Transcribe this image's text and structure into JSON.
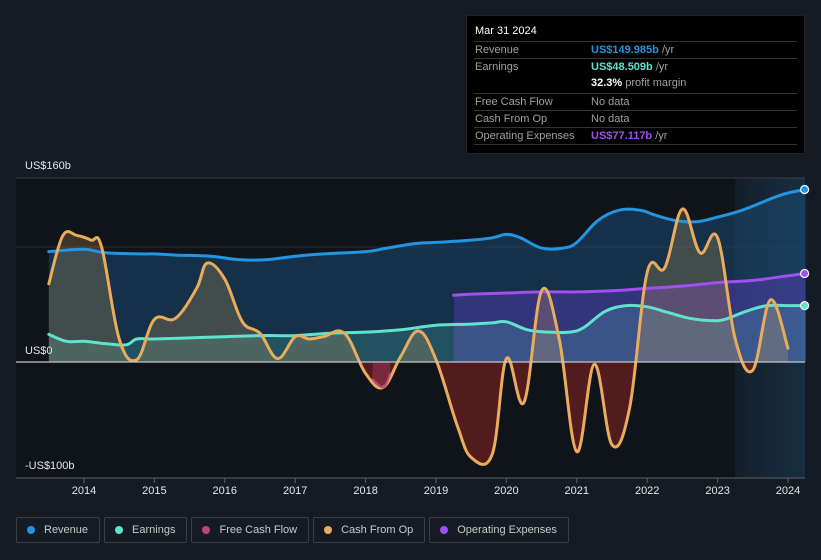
{
  "tooltip": {
    "date": "Mar 31 2024",
    "rows": [
      {
        "label": "Revenue",
        "value": "US$149.985b",
        "suffix": " /yr",
        "color": "#2394df"
      },
      {
        "label": "Earnings",
        "value": "US$48.509b",
        "suffix": " /yr",
        "color": "#5fe3cc"
      },
      {
        "label": "",
        "value": "32.3%",
        "suffix": " profit margin",
        "color": "#ffffff"
      },
      {
        "label": "Free Cash Flow",
        "value": "",
        "suffix": "No data",
        "color": "#6f6f6f"
      },
      {
        "label": "Cash From Op",
        "value": "",
        "suffix": "No data",
        "color": "#6f6f6f"
      },
      {
        "label": "Operating Expenses",
        "value": "US$77.117b",
        "suffix": " /yr",
        "color": "#a14ff0"
      }
    ]
  },
  "legend": [
    {
      "label": "Revenue",
      "color": "#2394df"
    },
    {
      "label": "Earnings",
      "color": "#5fe3cc"
    },
    {
      "label": "Free Cash Flow",
      "color": "#c0447a"
    },
    {
      "label": "Cash From Op",
      "color": "#e9ac5c"
    },
    {
      "label": "Operating Expenses",
      "color": "#a14ff0"
    }
  ],
  "chart_data": {
    "type": "area",
    "title": "",
    "xlabel": "",
    "ylabel": "",
    "ylim": [
      -100,
      160
    ],
    "y_tick_labels": [
      "US$160b",
      "US$0",
      "-US$100b"
    ],
    "x_tick_labels": [
      "2014",
      "2015",
      "2016",
      "2017",
      "2018",
      "2019",
      "2020",
      "2021",
      "2022",
      "2023",
      "2024"
    ],
    "x_ticks": [
      2014,
      2015,
      2016,
      2017,
      2018,
      2019,
      2020,
      2021,
      2022,
      2023,
      2024
    ],
    "xlim": [
      2013.2,
      2024.25
    ],
    "forecast_start": 2023.25,
    "grid": true,
    "legend_position": "bottom",
    "series": [
      {
        "name": "Revenue",
        "color": "#2394df",
        "x": [
          2013.5,
          2014.0,
          2014.3,
          2014.8,
          2015.0,
          2015.3,
          2015.8,
          2016.2,
          2016.6,
          2017.0,
          2017.4,
          2018.0,
          2018.3,
          2018.7,
          2019.0,
          2019.5,
          2019.8,
          2020.0,
          2020.2,
          2020.5,
          2020.8,
          2021.0,
          2021.3,
          2021.6,
          2021.9,
          2022.1,
          2022.4,
          2022.7,
          2023.0,
          2023.3,
          2023.6,
          2023.8,
          2024.0,
          2024.25
        ],
        "values": [
          96,
          98,
          95,
          94,
          94,
          93,
          92,
          89,
          89,
          92,
          94,
          96,
          99,
          103,
          104,
          106,
          108,
          111,
          108,
          99,
          99,
          104,
          123,
          132,
          132,
          128,
          123,
          122,
          126,
          131,
          138,
          143,
          147,
          150
        ]
      },
      {
        "name": "Earnings",
        "color": "#5fe3cc",
        "x": [
          2013.5,
          2013.75,
          2014.0,
          2014.3,
          2014.6,
          2014.75,
          2015.0,
          2015.5,
          2016.0,
          2016.5,
          2017.0,
          2017.5,
          2018.0,
          2018.5,
          2019.0,
          2019.5,
          2019.8,
          2020.0,
          2020.3,
          2020.6,
          2020.9,
          2021.1,
          2021.4,
          2021.7,
          2022.0,
          2022.3,
          2022.6,
          2022.9,
          2023.1,
          2023.4,
          2023.7,
          2024.0,
          2024.25
        ],
        "values": [
          24,
          18,
          18,
          16,
          15,
          20,
          20,
          21,
          22,
          23,
          23,
          25,
          26,
          28,
          32,
          33,
          34,
          35,
          28,
          26,
          26,
          30,
          44,
          49,
          48,
          43,
          38,
          36,
          37,
          44,
          49,
          49,
          49
        ]
      },
      {
        "name": "Free Cash Flow",
        "color": "#c0447a",
        "x": [
          2018.1,
          2018.25,
          2018.35
        ],
        "values": [
          -15,
          -22,
          -10
        ]
      },
      {
        "name": "Cash From Op",
        "color": "#e9ac5c",
        "x": [
          2013.5,
          2013.7,
          2013.9,
          2014.1,
          2014.25,
          2014.5,
          2014.75,
          2015.0,
          2015.3,
          2015.6,
          2015.75,
          2016.0,
          2016.25,
          2016.5,
          2016.75,
          2017.0,
          2017.2,
          2017.4,
          2017.7,
          2018.0,
          2018.25,
          2018.5,
          2018.75,
          2019.0,
          2019.3,
          2019.5,
          2019.8,
          2020.0,
          2020.25,
          2020.5,
          2020.75,
          2021.0,
          2021.25,
          2021.5,
          2021.75,
          2022.0,
          2022.25,
          2022.5,
          2022.75,
          2023.0,
          2023.25,
          2023.5,
          2023.75,
          2024.0
        ],
        "values": [
          68,
          110,
          110,
          106,
          100,
          20,
          2,
          37,
          38,
          64,
          86,
          72,
          35,
          25,
          3,
          22,
          20,
          22,
          25,
          -10,
          -22,
          5,
          27,
          2,
          -55,
          -83,
          -80,
          3,
          -35,
          62,
          20,
          -78,
          -2,
          -72,
          -40,
          78,
          82,
          133,
          95,
          108,
          20,
          -7,
          54,
          12
        ]
      },
      {
        "name": "Operating Expenses",
        "color": "#a14ff0",
        "x": [
          2019.25,
          2019.5,
          2020.0,
          2020.5,
          2021.0,
          2021.5,
          2022.0,
          2022.5,
          2023.0,
          2023.5,
          2024.0,
          2024.25
        ],
        "values": [
          58,
          59,
          60,
          61,
          61,
          62,
          64,
          66,
          69,
          71,
          75,
          77
        ]
      }
    ]
  }
}
